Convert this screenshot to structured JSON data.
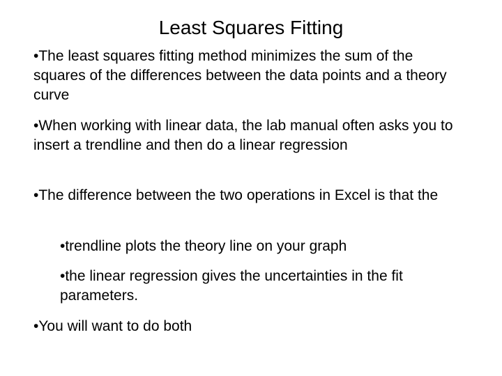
{
  "slide": {
    "title": "Least Squares Fitting",
    "bullets": [
      "•The least squares fitting method minimizes the sum of the squares of the differences between the data points and a theory curve",
      "•When working with linear data, the lab manual often asks you to insert a trendline and then do a linear regression",
      "•The difference between the two operations in Excel is that the"
    ],
    "sub_bullets": [
      "•trendline plots the theory line on your graph",
      "•the linear regression gives the uncertainties in the fit parameters."
    ],
    "final_bullet": "•You will want to do both"
  }
}
